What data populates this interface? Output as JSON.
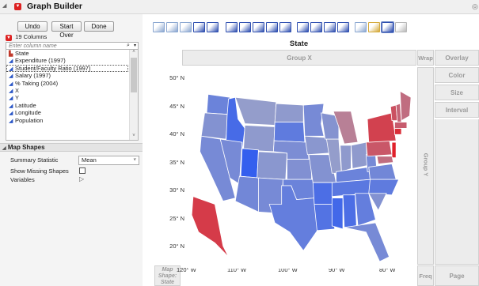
{
  "window": {
    "title": "Graph Builder"
  },
  "toolbar": {
    "undo": "Undo",
    "start_over": "Start Over",
    "done": "Done"
  },
  "columns": {
    "count_label": "19 Columns",
    "search_placeholder": "Enter column name",
    "items": [
      {
        "name": "State",
        "icon": "nominal-icon",
        "color": "#c0392b"
      },
      {
        "name": "Expenditure (1997)",
        "icon": "continuous-icon",
        "color": "#2a56c6"
      },
      {
        "name": "Student/Faculty Ratio (1997)",
        "icon": "continuous-icon",
        "color": "#2a56c6"
      },
      {
        "name": "Salary (1997)",
        "icon": "continuous-icon",
        "color": "#2a56c6"
      },
      {
        "name": "% Taking (2004)",
        "icon": "continuous-icon",
        "color": "#2a56c6"
      },
      {
        "name": "X",
        "icon": "continuous-icon",
        "color": "#2a56c6"
      },
      {
        "name": "Y",
        "icon": "continuous-icon",
        "color": "#2a56c6"
      },
      {
        "name": "Latitude",
        "icon": "continuous-icon",
        "color": "#2a56c6"
      },
      {
        "name": "Longitude",
        "icon": "continuous-icon",
        "color": "#2a56c6"
      },
      {
        "name": "Population",
        "icon": "continuous-icon",
        "color": "#2a56c6"
      }
    ]
  },
  "map_shapes": {
    "section_title": "Map Shapes",
    "summary_statistic_label": "Summary Statistic",
    "summary_statistic_value": "Mean",
    "show_missing_label": "Show Missing Shapes",
    "variables_label": "Variables"
  },
  "graph": {
    "title": "State",
    "group_x": "Group X",
    "group_y": "Group Y",
    "wrap": "Wrap",
    "overlay": "Overlay",
    "color": "Color",
    "size": "Size",
    "interval": "Interval",
    "freq": "Freq",
    "page": "Page",
    "map_shape_zone": "Map Shape: State",
    "y_ticks": [
      "50° N",
      "45° N",
      "40° N",
      "35° N",
      "30° N",
      "25° N",
      "20° N"
    ],
    "x_ticks": [
      "120° W",
      "110° W",
      "100° W",
      "90° W",
      "80° W"
    ]
  },
  "colors": {
    "high": "#e0202a",
    "low": "#2f5cf0",
    "mid": "#a7a9c4"
  }
}
